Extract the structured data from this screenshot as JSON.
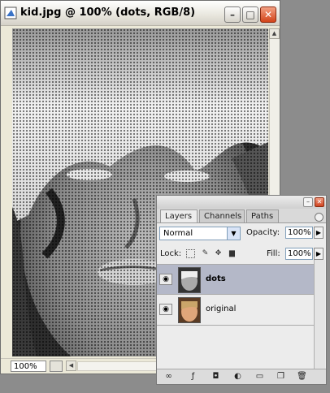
{
  "document": {
    "title": "kid.jpg @ 100% (dots, RGB/8)",
    "zoom": "100%",
    "window_controls": {
      "minimize": "–",
      "restore": "□",
      "close": "✕"
    }
  },
  "layers_panel": {
    "tabs": [
      "Layers",
      "Channels",
      "Paths"
    ],
    "active_tab": "Layers",
    "blend_mode": "Normal",
    "opacity_label": "Opacity:",
    "opacity_value": "100%",
    "lock_label": "Lock:",
    "fill_label": "Fill:",
    "fill_value": "100%",
    "layers": [
      {
        "name": "dots",
        "selected": true,
        "visible": true
      },
      {
        "name": "original",
        "selected": false,
        "visible": true
      }
    ],
    "bottom_icons": [
      "link-icon",
      "layer-style-icon",
      "mask-icon",
      "adjustment-layer-icon",
      "new-group-icon",
      "new-layer-icon",
      "trash-icon"
    ]
  },
  "colors": {
    "desktop": "#8c8c8c",
    "selected_layer": "#b4b8c8",
    "close_button": "#d24318"
  }
}
